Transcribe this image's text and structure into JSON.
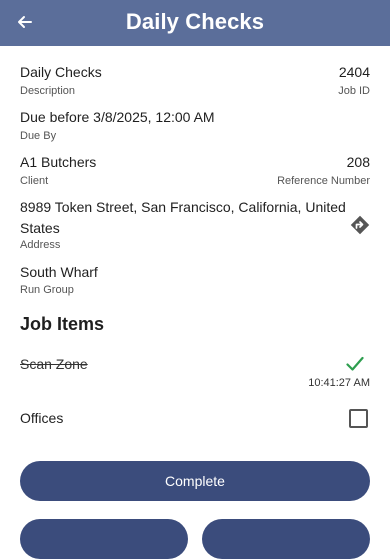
{
  "header": {
    "title": "Daily Checks",
    "back_icon": "arrow-left-icon"
  },
  "details": {
    "description_value": "Daily Checks",
    "description_label": "Description",
    "job_id_value": "2404",
    "job_id_label": "Job ID",
    "due_value": "Due before 3/8/2025, 12:00 AM",
    "due_label": "Due By",
    "client_value": "A1 Butchers",
    "client_label": "Client",
    "reference_value": "208",
    "reference_label": "Reference Number",
    "address_line1": "8989 Token Street, San Francisco, California, United",
    "address_line2": "States",
    "address_label": "Address",
    "directions_icon": "directions-icon",
    "run_group_value": "South Wharf",
    "run_group_label": "Run Group"
  },
  "job_items": {
    "title": "Job Items",
    "items": [
      {
        "name": "Scan Zone",
        "completed": true,
        "time": "10:41:27 AM",
        "icon": "check-icon"
      },
      {
        "name": "Offices",
        "completed": false,
        "icon": "checkbox-icon"
      }
    ]
  },
  "actions": {
    "complete_label": "Complete"
  },
  "colors": {
    "header_bg": "#5b6e9a",
    "button_bg": "#3b4c7c",
    "check_green": "#2e9e4f"
  }
}
